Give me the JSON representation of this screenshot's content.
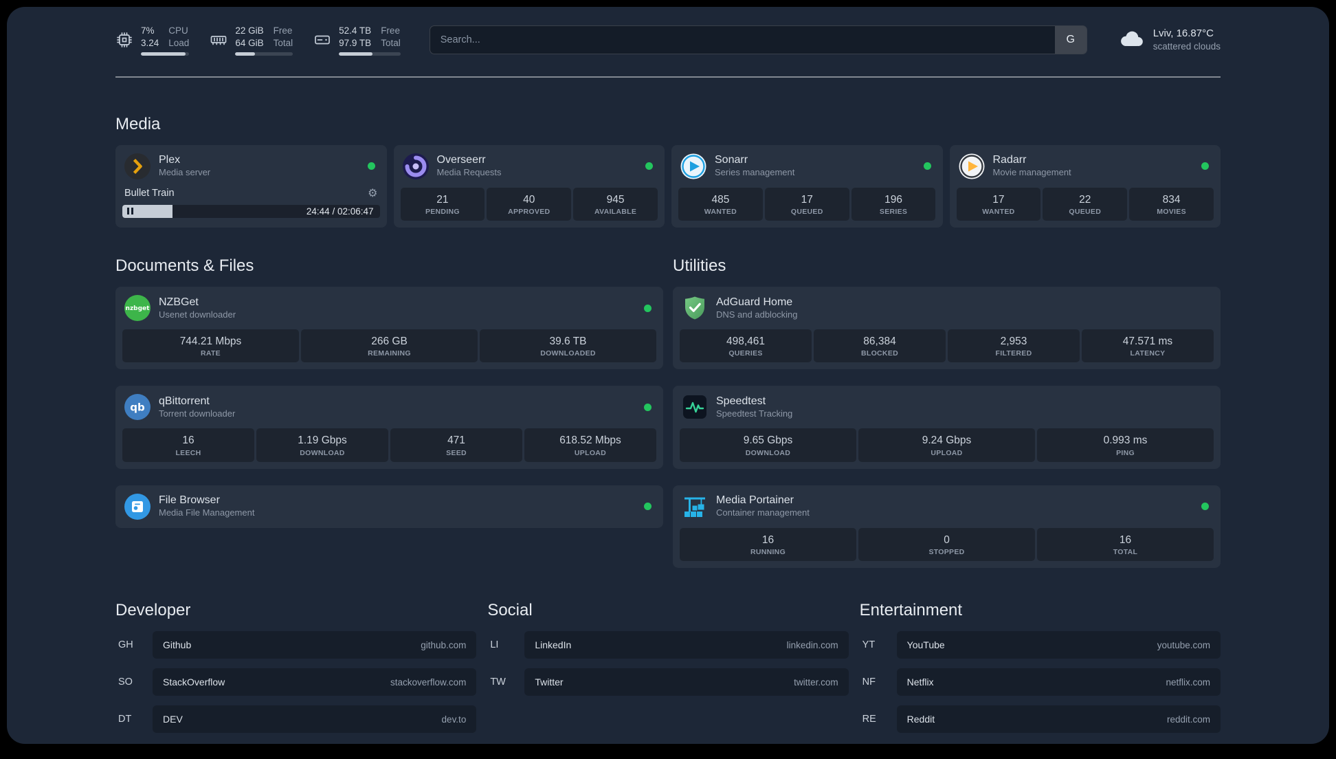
{
  "topbar": {
    "resources": [
      {
        "icon": "cpu-icon",
        "value_line1": "7%",
        "value_line2": "3.24",
        "label_line1": "CPU",
        "label_line2": "Load",
        "bar_percent": 93
      },
      {
        "icon": "memory-icon",
        "value_line1": "22 GiB",
        "value_line2": "64 GiB",
        "label_line1": "Free",
        "label_line2": "Total",
        "bar_percent": 34
      },
      {
        "icon": "disk-icon",
        "value_line1": "52.4 TB",
        "value_line2": "97.9 TB",
        "label_line1": "Free",
        "label_line2": "Total",
        "bar_percent": 54
      }
    ],
    "search": {
      "placeholder": "Search...",
      "button": "G"
    },
    "weather": {
      "icon": "cloud-icon",
      "location": "Lviv, 16.87°C",
      "condition": "scattered clouds"
    }
  },
  "groups": {
    "media": {
      "title": "Media",
      "plex": {
        "icon": "plex-icon",
        "name": "Plex",
        "desc": "Media server",
        "status": "online",
        "now_playing": "Bullet Train",
        "time_display": "24:44 / 02:06:47",
        "elapsed": "24:44",
        "duration": "02:06:47",
        "progress_percent": 19.5
      },
      "overseerr": {
        "icon": "overseerr-icon",
        "name": "Overseerr",
        "desc": "Media Requests",
        "status": "online",
        "stats": [
          {
            "value": "21",
            "label": "PENDING"
          },
          {
            "value": "40",
            "label": "APPROVED"
          },
          {
            "value": "945",
            "label": "AVAILABLE"
          }
        ]
      },
      "sonarr": {
        "icon": "sonarr-icon",
        "name": "Sonarr",
        "desc": "Series management",
        "status": "online",
        "stats": [
          {
            "value": "485",
            "label": "WANTED"
          },
          {
            "value": "17",
            "label": "QUEUED"
          },
          {
            "value": "196",
            "label": "SERIES"
          }
        ]
      },
      "radarr": {
        "icon": "radarr-icon",
        "name": "Radarr",
        "desc": "Movie management",
        "status": "online",
        "stats": [
          {
            "value": "17",
            "label": "WANTED"
          },
          {
            "value": "22",
            "label": "QUEUED"
          },
          {
            "value": "834",
            "label": "MOVIES"
          }
        ]
      }
    },
    "documents": {
      "title": "Documents & Files",
      "nzbget": {
        "icon": "nzbget-icon",
        "name": "NZBGet",
        "desc": "Usenet downloader",
        "status": "online",
        "stats": [
          {
            "value": "744.21 Mbps",
            "label": "RATE"
          },
          {
            "value": "266 GB",
            "label": "REMAINING"
          },
          {
            "value": "39.6 TB",
            "label": "DOWNLOADED"
          }
        ]
      },
      "qbittorrent": {
        "icon": "qbittorrent-icon",
        "name": "qBittorrent",
        "desc": "Torrent downloader",
        "status": "online",
        "stats": [
          {
            "value": "16",
            "label": "LEECH"
          },
          {
            "value": "1.19 Gbps",
            "label": "DOWNLOAD"
          },
          {
            "value": "471",
            "label": "SEED"
          },
          {
            "value": "618.52 Mbps",
            "label": "UPLOAD"
          }
        ]
      },
      "filebrowser": {
        "icon": "filebrowser-icon",
        "name": "File Browser",
        "desc": "Media File Management",
        "status": "online"
      }
    },
    "utilities": {
      "title": "Utilities",
      "adguard": {
        "icon": "adguard-icon",
        "name": "AdGuard Home",
        "desc": "DNS and adblocking",
        "stats": [
          {
            "value": "498,461",
            "label": "QUERIES"
          },
          {
            "value": "86,384",
            "label": "BLOCKED"
          },
          {
            "value": "2,953",
            "label": "FILTERED"
          },
          {
            "value": "47.571 ms",
            "label": "LATENCY"
          }
        ]
      },
      "speedtest": {
        "icon": "speedtest-icon",
        "name": "Speedtest",
        "desc": "Speedtest Tracking",
        "stats": [
          {
            "value": "9.65 Gbps",
            "label": "DOWNLOAD"
          },
          {
            "value": "9.24 Gbps",
            "label": "UPLOAD"
          },
          {
            "value": "0.993 ms",
            "label": "PING"
          }
        ]
      },
      "portainer": {
        "icon": "portainer-icon",
        "name": "Media Portainer",
        "desc": "Container management",
        "status": "online",
        "stats": [
          {
            "value": "16",
            "label": "RUNNING"
          },
          {
            "value": "0",
            "label": "STOPPED"
          },
          {
            "value": "16",
            "label": "TOTAL"
          }
        ]
      }
    }
  },
  "bookmarks": {
    "developer": {
      "title": "Developer",
      "items": [
        {
          "abbr": "GH",
          "name": "Github",
          "domain": "github.com"
        },
        {
          "abbr": "SO",
          "name": "StackOverflow",
          "domain": "stackoverflow.com"
        },
        {
          "abbr": "DT",
          "name": "DEV",
          "domain": "dev.to"
        }
      ]
    },
    "social": {
      "title": "Social",
      "items": [
        {
          "abbr": "LI",
          "name": "LinkedIn",
          "domain": "linkedin.com"
        },
        {
          "abbr": "TW",
          "name": "Twitter",
          "domain": "twitter.com"
        }
      ]
    },
    "entertainment": {
      "title": "Entertainment",
      "items": [
        {
          "abbr": "YT",
          "name": "YouTube",
          "domain": "youtube.com"
        },
        {
          "abbr": "NF",
          "name": "Netflix",
          "domain": "netflix.com"
        },
        {
          "abbr": "RE",
          "name": "Reddit",
          "domain": "reddit.com"
        }
      ]
    }
  },
  "colors": {
    "page_bg": "#1d2737",
    "status_online": "#23c55e",
    "plex_accent": "#e5a00d",
    "bar_fill": "#c6cdd6"
  }
}
